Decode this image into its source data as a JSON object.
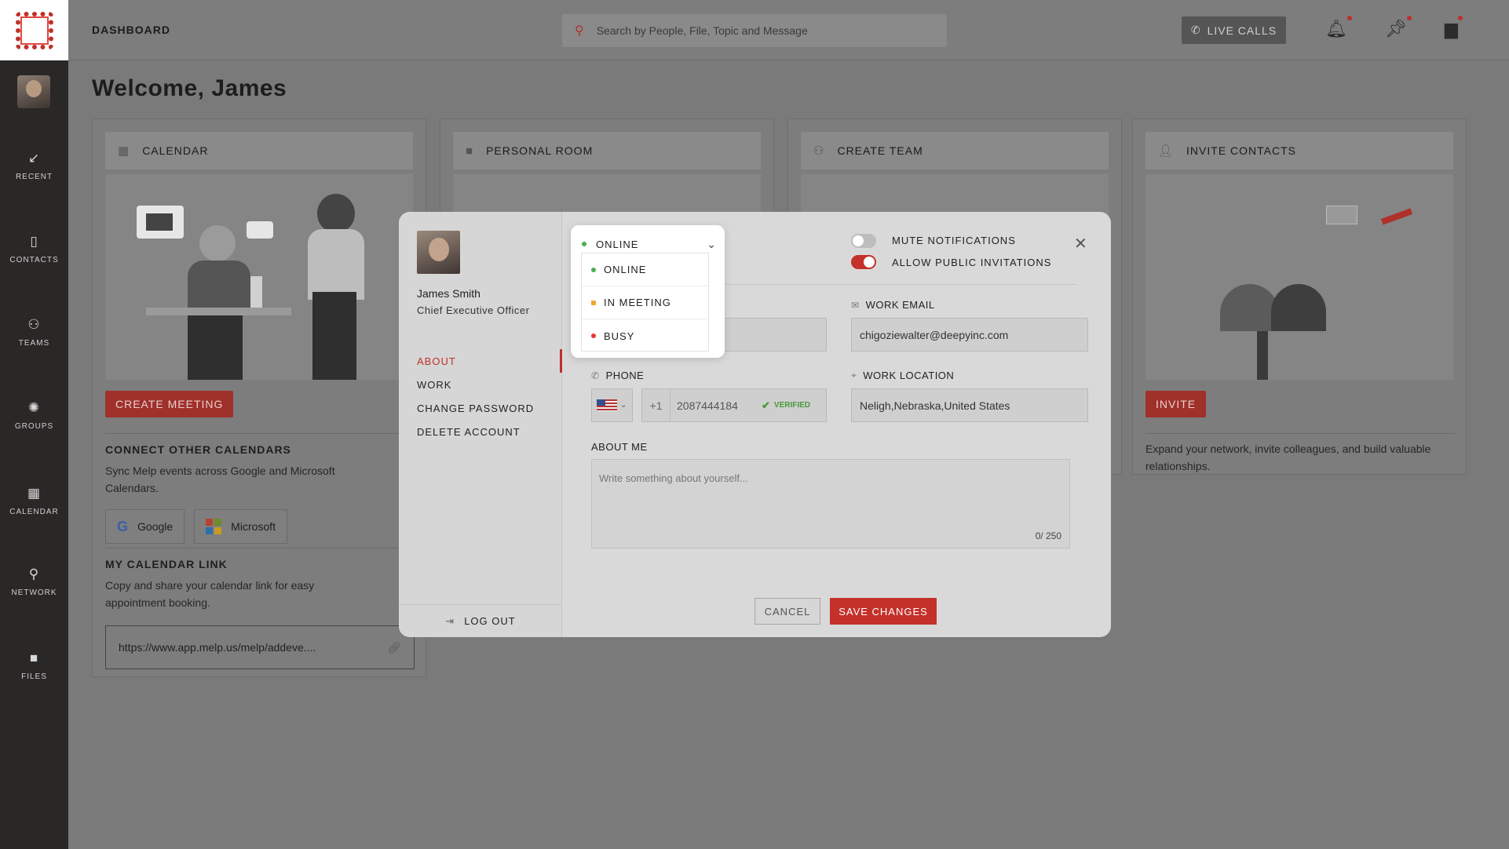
{
  "sidebar": {
    "items": [
      {
        "label": "RECENT",
        "icon": "arrow-down-left-icon"
      },
      {
        "label": "CONTACTS",
        "icon": "contacts-icon"
      },
      {
        "label": "TEAMS",
        "icon": "teams-icon"
      },
      {
        "label": "GROUPS",
        "icon": "groups-icon"
      },
      {
        "label": "CALENDAR",
        "icon": "calendar-icon"
      },
      {
        "label": "NETWORK",
        "icon": "network-icon"
      },
      {
        "label": "FILES",
        "icon": "folder-icon"
      }
    ]
  },
  "header": {
    "title": "DASHBOARD",
    "search_placeholder": "Search by People, File, Topic and Message",
    "live_calls_label": "LIVE CALLS"
  },
  "main": {
    "welcome": "Welcome, James",
    "cards": [
      {
        "title": "CALENDAR",
        "icon": "calendar-icon"
      },
      {
        "title": "PERSONAL ROOM",
        "icon": "video-icon"
      },
      {
        "title": "CREATE TEAM",
        "icon": "team-icon"
      },
      {
        "title": "INVITE CONTACTS",
        "icon": "add-user-icon"
      }
    ],
    "calendar": {
      "create_meeting_label": "CREATE MEETING",
      "connect_title": "CONNECT OTHER CALENDARS",
      "connect_desc": "Sync Melp events across Google and Microsoft Calendars.",
      "google_label": "Google",
      "microsoft_label": "Microsoft",
      "link_title": "MY CALENDAR LINK",
      "link_desc": "Copy and share your calendar link for easy appointment booking.",
      "link_value": "https://www.app.melp.us/melp/addeve...."
    },
    "invite": {
      "button_label": "INVITE",
      "desc": "Expand your network, invite colleagues, and build valuable relationships."
    }
  },
  "modal": {
    "user_name": "James Smith",
    "user_role": "Chief Executive Officer",
    "menu": [
      "ABOUT",
      "WORK",
      "CHANGE PASSWORD",
      "DELETE ACCOUNT"
    ],
    "logout_label": "LOG OUT",
    "status": {
      "selected": "ONLINE",
      "options": [
        {
          "label": "ONLINE",
          "color": "#4caf50"
        },
        {
          "label": "IN MEETING",
          "color": "#f0a830"
        },
        {
          "label": "BUSY",
          "color": "#e53935"
        }
      ]
    },
    "toggles": {
      "mute_label": "MUTE NOTIFICATIONS",
      "mute_on": false,
      "public_label": "ALLOW PUBLIC INVITATIONS",
      "public_on": true
    },
    "work_email_label": "WORK EMAIL",
    "work_email_value": "chigoziewalter@deepyinc.com",
    "phone_label": "PHONE",
    "phone_code": "+1",
    "phone_value": "2087444184",
    "verified_label": "VERIFIED",
    "work_location_label": "WORK LOCATION",
    "work_location_value": "Neligh,Nebraska,United States",
    "about_label": "ABOUT ME",
    "about_placeholder": "Write something about yourself...",
    "about_counter": "0/ 250",
    "cancel_label": "CANCEL",
    "save_label": "SAVE CHANGES"
  },
  "colors": {
    "accent": "#c4302a",
    "sidebar_bg": "#2a2727",
    "online": "#4caf50"
  }
}
